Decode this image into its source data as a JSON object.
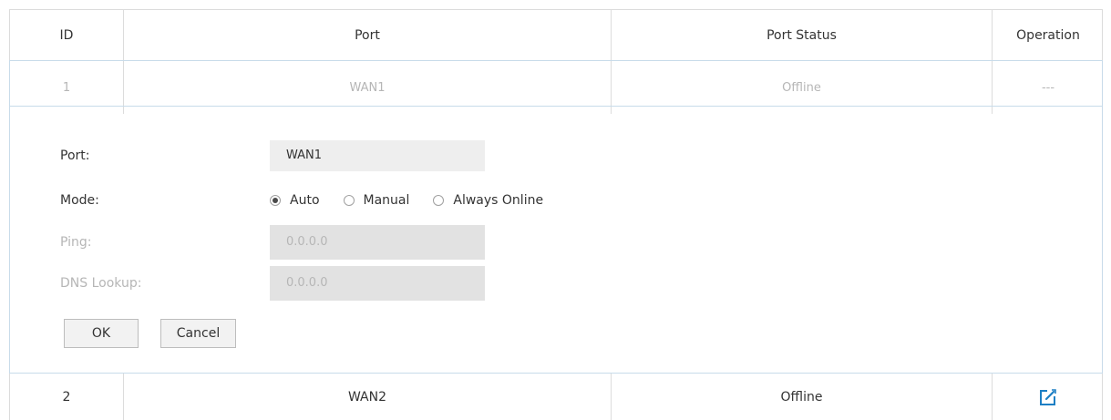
{
  "table": {
    "headers": {
      "id": "ID",
      "port": "Port",
      "status": "Port Status",
      "operation": "Operation"
    },
    "rows": [
      {
        "id": "1",
        "port": "WAN1",
        "status": "Offline",
        "operation": "---"
      },
      {
        "id": "2",
        "port": "WAN2",
        "status": "Offline",
        "operation_icon": "edit-icon"
      }
    ]
  },
  "edit_form": {
    "port_label": "Port:",
    "port_value": "WAN1",
    "mode_label": "Mode:",
    "mode_options": [
      "Auto",
      "Manual",
      "Always Online"
    ],
    "mode_selected": "Auto",
    "ping_label": "Ping:",
    "ping_value": "0.0.0.0",
    "dns_label": "DNS Lookup:",
    "dns_value": "0.0.0.0",
    "ok_label": "OK",
    "cancel_label": "Cancel"
  },
  "colors": {
    "accent": "#1d7fc4",
    "border": "#dcdcdc",
    "panel_border": "#c8dbea",
    "disabled_text": "#b6b6b6"
  }
}
